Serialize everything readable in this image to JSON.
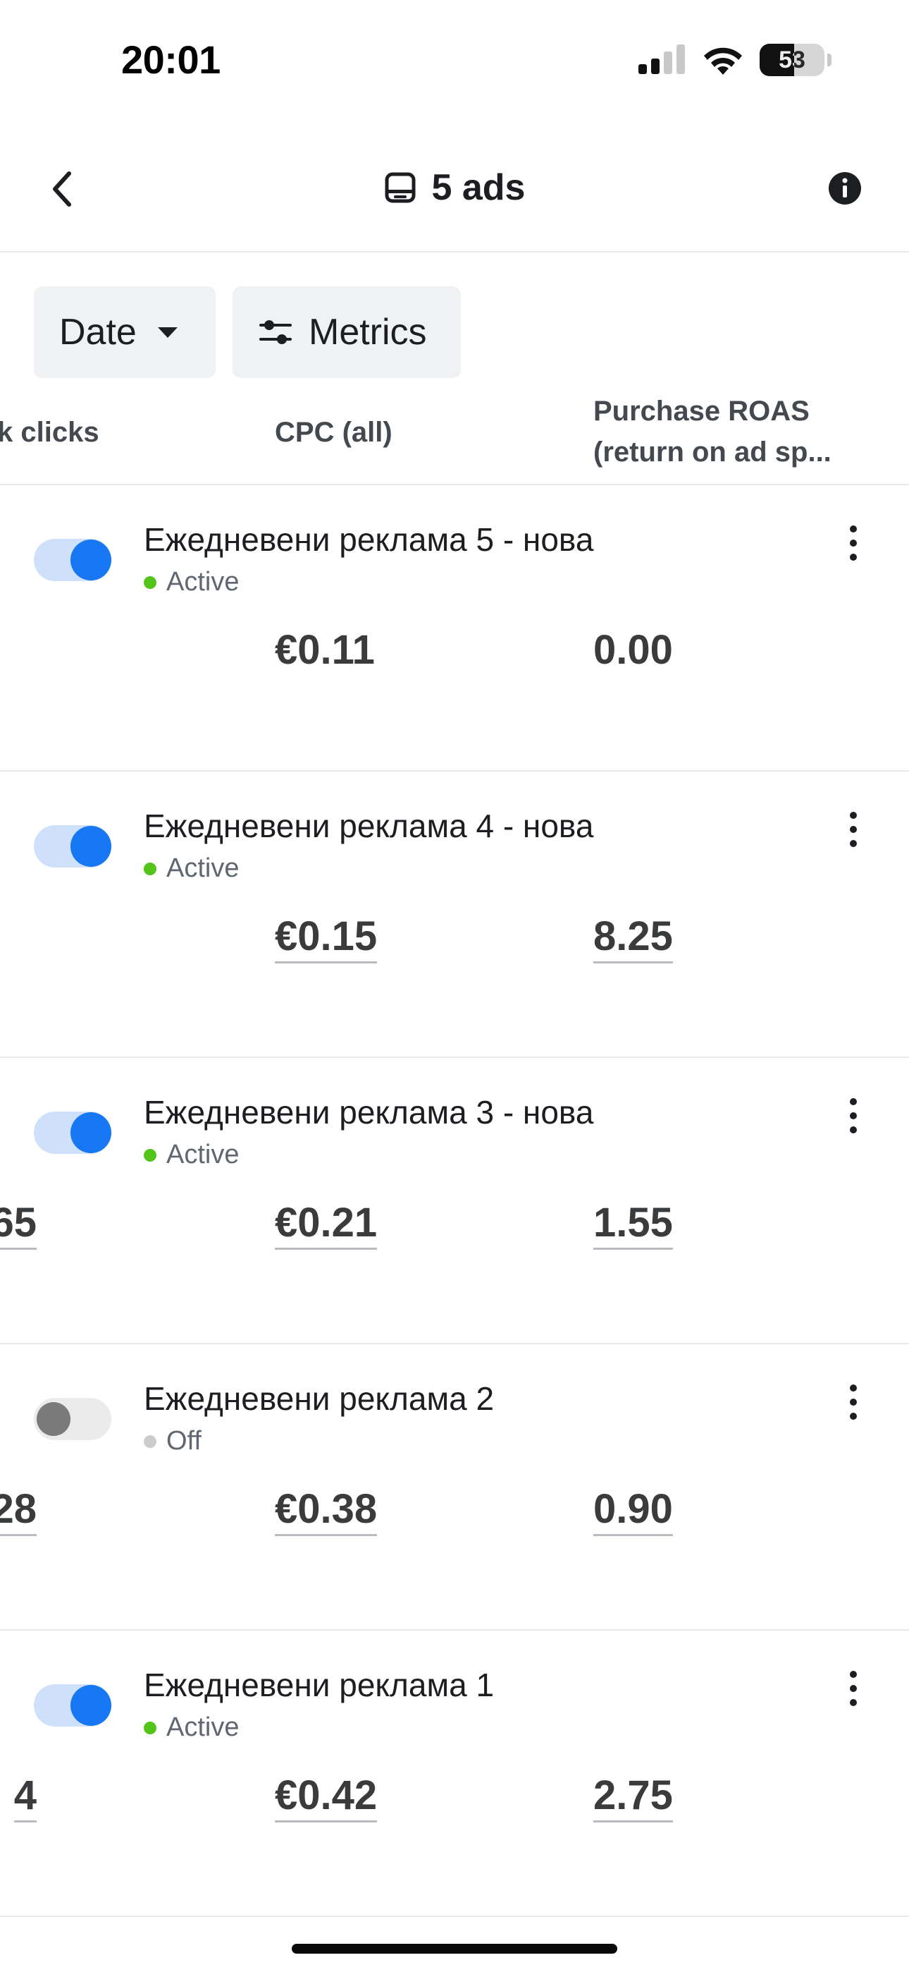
{
  "status_bar": {
    "time": "20:01",
    "battery": "53"
  },
  "header": {
    "title": "5 ads"
  },
  "filters": {
    "date_label": "Date",
    "metrics_label": "Metrics"
  },
  "columns": {
    "link_clicks": "k clicks",
    "cpc": "CPC (all)",
    "roas_line1": "Purchase ROAS",
    "roas_line2": "(return on ad sp..."
  },
  "colors": {
    "accent": "#1877f2",
    "active_dot": "#52c41a",
    "off_dot": "#cccccc"
  },
  "ads": [
    {
      "name": "Ежедневени реклама 5 - нова",
      "status": "Active",
      "on": true,
      "partial": "",
      "cpc": "€0.11",
      "roas": "0.00"
    },
    {
      "name": "Ежедневени реклама 4 - нова",
      "status": "Active",
      "on": true,
      "partial": "",
      "cpc": "€0.15",
      "roas": "8.25"
    },
    {
      "name": "Ежедневени реклама 3 - нова",
      "status": "Active",
      "on": true,
      "partial": "65",
      "cpc": "€0.21",
      "roas": "1.55"
    },
    {
      "name": "Ежедневени реклама 2",
      "status": "Off",
      "on": false,
      "partial": "28",
      "cpc": "€0.38",
      "roas": "0.90"
    },
    {
      "name": "Ежедневени реклама 1",
      "status": "Active",
      "on": true,
      "partial": "4",
      "cpc": "€0.42",
      "roas": "2.75"
    }
  ]
}
